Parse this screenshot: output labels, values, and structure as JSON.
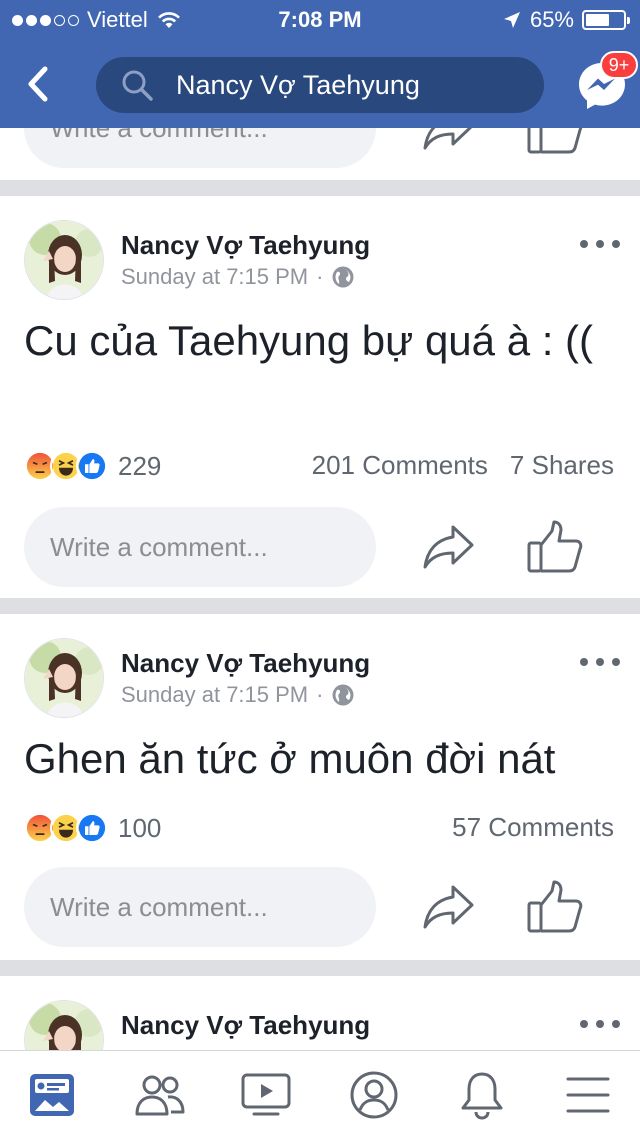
{
  "status_bar": {
    "carrier": "Viettel",
    "time": "7:08 PM",
    "battery_percent": "65%",
    "battery_level": 0.65,
    "signal_bars": 3
  },
  "nav": {
    "search_text": "Nancy Vợ Taehyung",
    "messenger_badge": "9+"
  },
  "top_partial": {
    "comment_placeholder": "Write a comment..."
  },
  "posts": [
    {
      "author": "Nancy Vợ Taehyung",
      "time": "Sunday at 7:15 PM",
      "separator": "·",
      "text": "Cu của Taehyung bự quá à : ((",
      "reaction_count": "229",
      "comments": "201 Comments",
      "shares": "7 Shares",
      "comment_placeholder": "Write a comment..."
    },
    {
      "author": "Nancy Vợ Taehyung",
      "time": "Sunday at 7:15 PM",
      "separator": "·",
      "text": "Ghen ăn tức ở muôn đời nát",
      "reaction_count": "100",
      "comments": "57 Comments",
      "comment_placeholder": "Write a comment..."
    },
    {
      "author": "Nancy Vợ Taehyung"
    }
  ],
  "colors": {
    "brand": "#4267b2",
    "search_bg": "#29487d",
    "badge": "#fa3e3e",
    "like": "#1877f2",
    "angry": "#f7714c",
    "haha": "#fcd24c"
  },
  "tabbar_icons": [
    "news-feed-icon",
    "friends-icon",
    "watch-icon",
    "profile-icon",
    "notifications-icon",
    "menu-icon"
  ]
}
